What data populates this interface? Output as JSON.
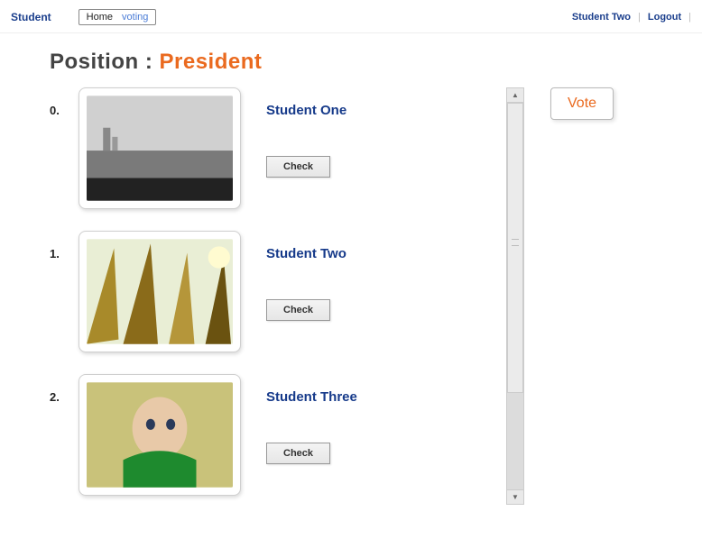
{
  "topbar": {
    "brand": "Student",
    "breadcrumb": {
      "home": "Home",
      "current": "voting"
    },
    "user": "Student Two",
    "logout": "Logout"
  },
  "title": {
    "label": "Position : ",
    "value": "President"
  },
  "vote_label": "Vote",
  "check_label": "Check",
  "candidates": [
    {
      "idx": "0.",
      "name": "Student One"
    },
    {
      "idx": "1.",
      "name": "Student Two"
    },
    {
      "idx": "2.",
      "name": "Student Three"
    }
  ]
}
